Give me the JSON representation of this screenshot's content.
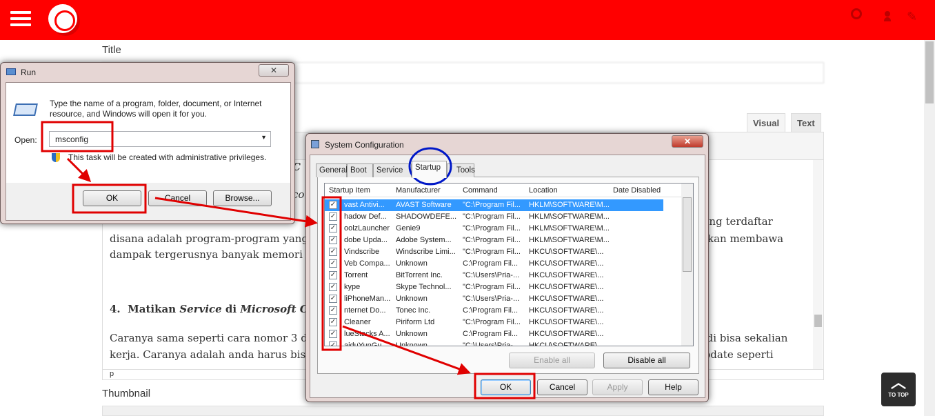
{
  "header": {
    "menu_icon": "hamburger-icon",
    "logo_icon": "logo-icon",
    "icons": [
      "search-icon",
      "user-icon",
      "pencil-icon"
    ]
  },
  "form": {
    "title_label": "Title",
    "title_value": "Cara Efektif Mempercepat Kerja Windows",
    "thumbnail_label": "Thumbnail"
  },
  "editor": {
    "tabs": [
      "Visual",
      "Text"
    ],
    "lines": [
      {
        "left": "disana adalah program-program yang al",
        "right": "kan membawa"
      },
      {
        "left": "dampak tergerusnya banyak memori dan",
        "right": ""
      }
    ],
    "line0_right": "yang terdaftar",
    "partial1": "C",
    "partial2": "co",
    "heading_num": "4.",
    "heading_a": "Matikan ",
    "heading_b": "Service",
    "heading_c": " di ",
    "heading_d": "Microsoft Co",
    "para1_left": "Caranya sama seperti cara nomor 3 diata",
    "para1_right": "jadi bisa sekalian",
    "para2_left": "kerja. Caranya adalah anda harus bisa m",
    "para2_right": "update seperti",
    "status": "p"
  },
  "to_top": "TO TOP",
  "run_dialog": {
    "title": "Run",
    "close": "✕",
    "description": "Type the name of a program, folder, document, or Internet resource, and Windows will open it for you.",
    "open_label": "Open:",
    "open_value": "msconfig",
    "admin_note": "This task will be created with administrative privileges.",
    "ok": "OK",
    "cancel": "Cancel",
    "browse": "Browse..."
  },
  "sysconfig": {
    "title": "System Configuration",
    "close": "✕",
    "tabs": [
      "General",
      "Boot",
      "Service",
      "Startup",
      "Tools"
    ],
    "columns": [
      "Startup Item",
      "Manufacturer",
      "Command",
      "Location",
      "Date Disabled"
    ],
    "rows": [
      [
        "vast Antivi...",
        "AVAST Software",
        "\"C:\\Program Fil...",
        "HKLM\\SOFTWARE\\M...",
        ""
      ],
      [
        "hadow Def...",
        "SHADOWDEFE...",
        "\"C:\\Program Fil...",
        "HKLM\\SOFTWARE\\M...",
        ""
      ],
      [
        "oolzLauncher",
        "Genie9",
        "\"C:\\Program Fil...",
        "HKLM\\SOFTWARE\\M...",
        ""
      ],
      [
        "dobe Upda...",
        "Adobe System...",
        "\"C:\\Program Fil...",
        "HKLM\\SOFTWARE\\M...",
        ""
      ],
      [
        "Vindscribe",
        "Windscribe Limi...",
        "\"C:\\Program Fil...",
        "HKCU\\SOFTWARE\\...",
        ""
      ],
      [
        "Veb Compa...",
        "Unknown",
        "C:\\Program Fil...",
        "HKCU\\SOFTWARE\\...",
        ""
      ],
      [
        "Torrent",
        "BitTorrent Inc.",
        "\"C:\\Users\\Pria-...",
        "HKCU\\SOFTWARE\\...",
        ""
      ],
      [
        "kype",
        "Skype Technol...",
        "\"C:\\Program Fil...",
        "HKCU\\SOFTWARE\\...",
        ""
      ],
      [
        "liPhoneMan...",
        "Unknown",
        "\"C:\\Users\\Pria-...",
        "HKCU\\SOFTWARE\\...",
        ""
      ],
      [
        "nternet Do...",
        "Tonec Inc.",
        "C:\\Program Fil...",
        "HKCU\\SOFTWARE\\...",
        ""
      ],
      [
        "Cleaner",
        "Piriform Ltd",
        "\"C:\\Program Fil...",
        "HKCU\\SOFTWARE\\...",
        ""
      ],
      [
        "lueStacks A...",
        "Unknown",
        "C:\\Program Fil...",
        "HKCU\\SOFTWARE\\...",
        ""
      ],
      [
        "aiduYunGu...",
        "Unknown",
        "\"C:\\Users\\Pria-...",
        "HKCU\\SOFTWARE\\...",
        ""
      ]
    ],
    "enable_all": "Enable all",
    "disable_all": "Disable all",
    "ok": "OK",
    "cancel": "Cancel",
    "apply": "Apply",
    "help": "Help"
  },
  "colors": {
    "brand": "#ff0000",
    "annotation_red": "#e00000",
    "annotation_blue": "#0000cc",
    "selection": "#3399ff"
  }
}
